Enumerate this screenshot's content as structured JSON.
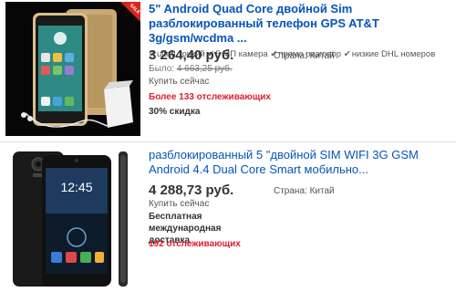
{
  "listings": [
    {
      "title": "5\" Android Quad Core двойной Sim разблокированный телефон GPS AT&T 3g/gsm/wcdma ...",
      "features": [
        "ultral тонкий",
        "5 МП камера",
        "прямо разговор",
        "низкие DHL номеров"
      ],
      "price": "3 264,40 руб.",
      "was_label": "Было:",
      "was_price": "4 663,25 руб.",
      "buy_now": "Купить сейчас",
      "country": "Страна: Китай",
      "watchers": "Более 133 отслеживающих",
      "discount": "30% скидка",
      "badge": "SALE"
    },
    {
      "title": "разблокированный 5 \"двойной SIM WIFI 3G GSM Android 4.4 Dual Core Smart мобильно...",
      "price": "4 288,73 руб.",
      "buy_now": "Купить сейчас",
      "country": "Страна: Китай",
      "shipping": "Бесплатная международная доставка",
      "watchers": "192 отслеживающих"
    }
  ],
  "colors": {
    "link": "#0654ba",
    "watchers": "#dd1e31",
    "badge": "#d9261c"
  }
}
